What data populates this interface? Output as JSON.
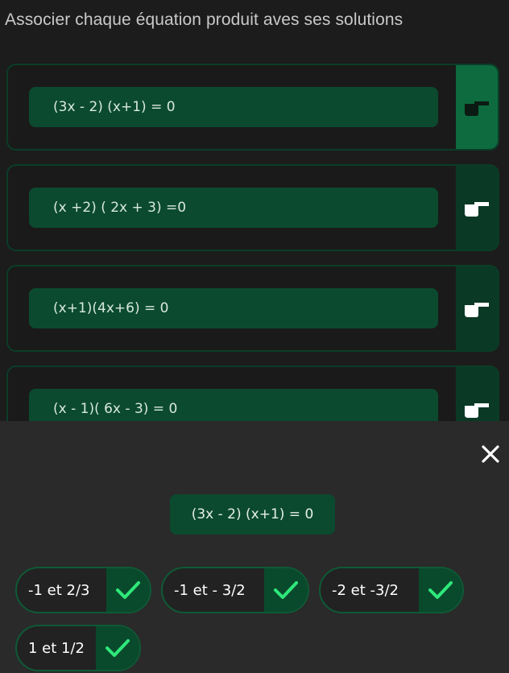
{
  "prompt": "Associer chaque équation produit aves ses solutions",
  "equations": [
    {
      "text": "(3x - 2) (x+1) = 0"
    },
    {
      "text": "(x +2) ( 2x + 3) =0"
    },
    {
      "text": "(x+1)(4x+6) = 0"
    },
    {
      "text": "(x - 1)( 6x - 3) = 0"
    }
  ],
  "sheet": {
    "selected_equation": "(3x - 2) (x+1) = 0",
    "choices": [
      {
        "label": "-1 et 2/3"
      },
      {
        "label": "-1 et - 3/2"
      },
      {
        "label": "-2 et -3/2"
      },
      {
        "label": "1 et 1/2"
      }
    ]
  },
  "colors": {
    "accent": "#0d6b3f",
    "pill": "#0b4a2e",
    "check": "#2ee87a"
  },
  "icons": {
    "handle": "pointing-hand-icon",
    "close": "close-icon",
    "check": "check-icon"
  }
}
